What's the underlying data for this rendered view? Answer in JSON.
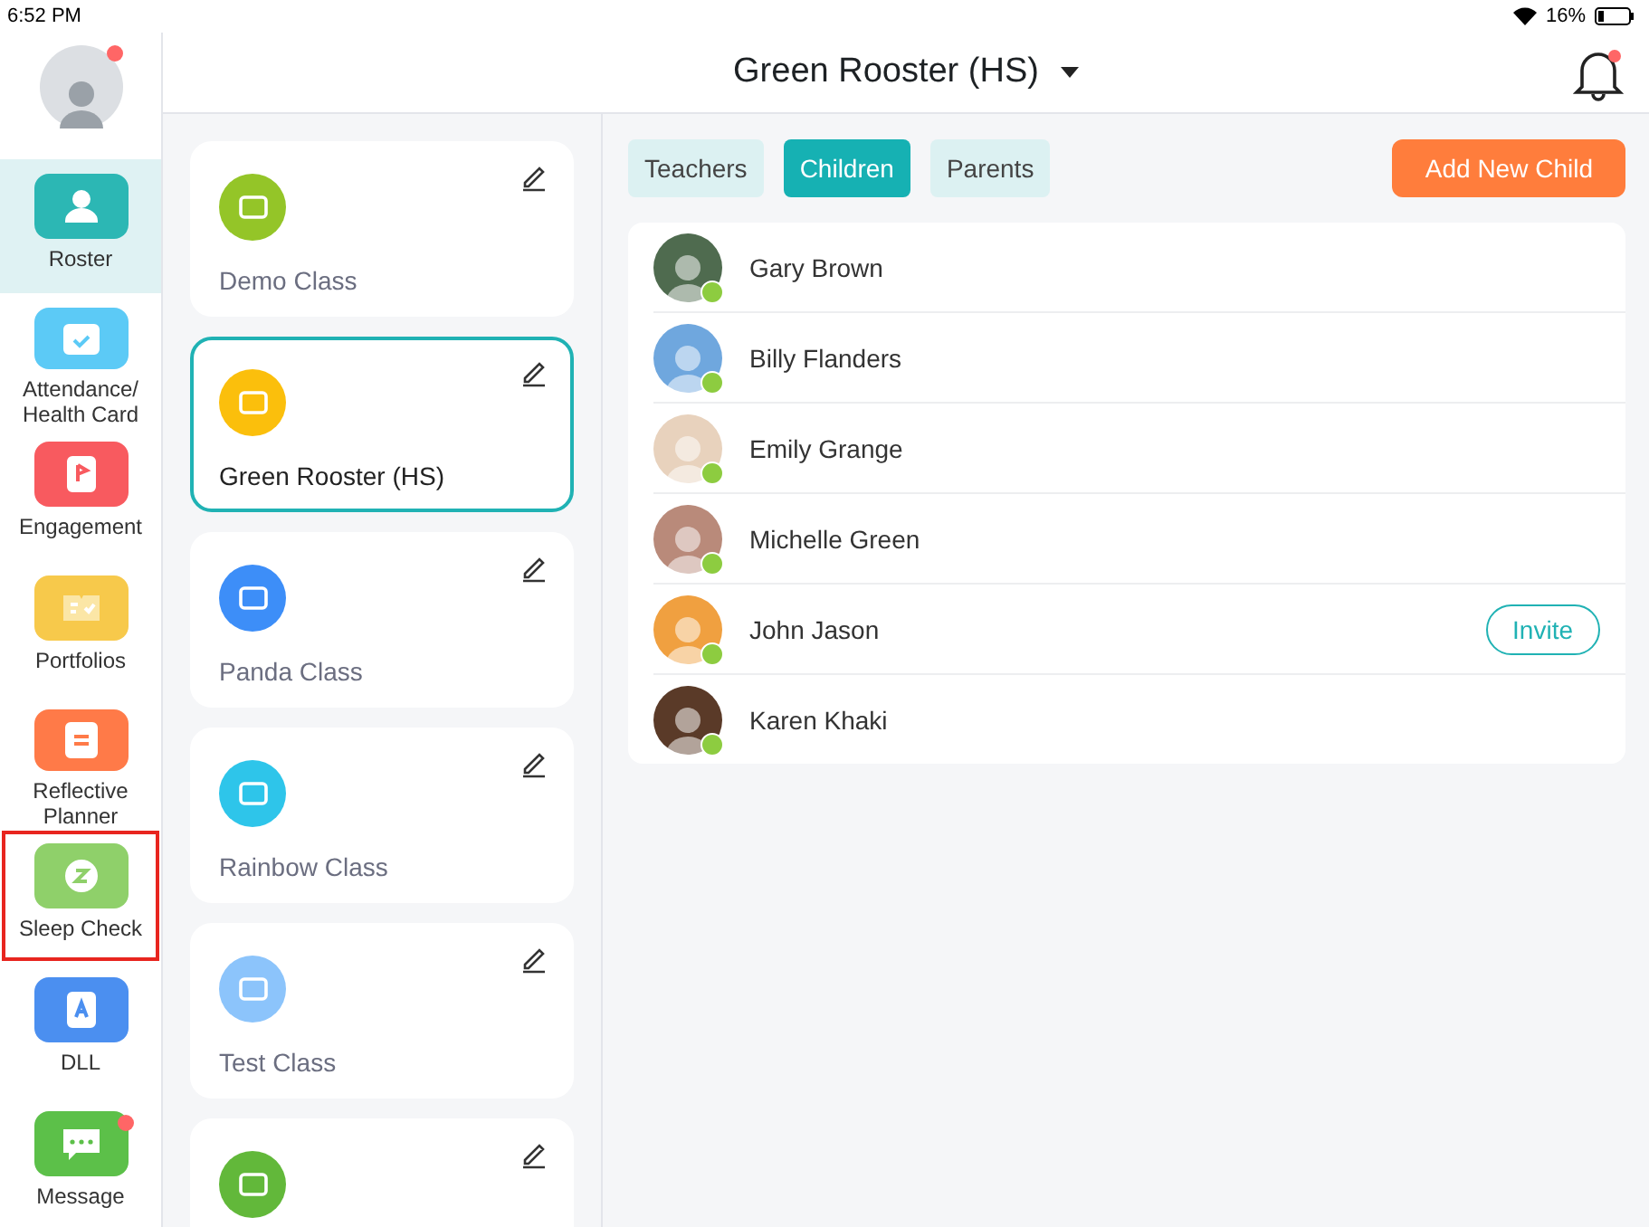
{
  "status_bar": {
    "time": "6:52 PM",
    "battery": "16%"
  },
  "user": {
    "notification": true
  },
  "nav": [
    {
      "label": "Roster",
      "kind": "person",
      "color": "#2cb7b4",
      "selected": true,
      "outlined": false,
      "badge": false
    },
    {
      "label": "Attendance/ Health Card",
      "kind": "calendar",
      "color": "#5ccaf6",
      "selected": false,
      "outlined": false,
      "badge": false
    },
    {
      "label": "Engagement",
      "kind": "flag",
      "color": "#f85a5f",
      "selected": false,
      "outlined": false,
      "badge": false
    },
    {
      "label": "Portfolios",
      "kind": "book",
      "color": "#f7c94b",
      "selected": false,
      "outlined": false,
      "badge": false
    },
    {
      "label": "Reflective Planner",
      "kind": "planner",
      "color": "#ff7a48",
      "selected": false,
      "outlined": false,
      "badge": false
    },
    {
      "label": "Sleep Check",
      "kind": "clock",
      "color": "#8fd06a",
      "selected": false,
      "outlined": true,
      "badge": false
    },
    {
      "label": "DLL",
      "kind": "letter",
      "color": "#4b8ff0",
      "selected": false,
      "outlined": false,
      "badge": false
    },
    {
      "label": "Message",
      "kind": "chat",
      "color": "#5cc049",
      "selected": false,
      "outlined": false,
      "badge": true
    }
  ],
  "header": {
    "title": "Green Rooster (HS)",
    "notification": true
  },
  "classes": [
    {
      "name": "Demo Class",
      "color": "#94c528",
      "selected": false
    },
    {
      "name": "Green Rooster (HS)",
      "color": "#fbbf0c",
      "selected": true
    },
    {
      "name": "Panda Class",
      "color": "#3d8ef8",
      "selected": false
    },
    {
      "name": "Rainbow Class",
      "color": "#2ec5ea",
      "selected": false
    },
    {
      "name": "Test Class",
      "color": "#8cc4fb",
      "selected": false
    },
    {
      "color": "#62b83a",
      "selected": false
    }
  ],
  "tabs": [
    {
      "label": "Teachers",
      "selected": false
    },
    {
      "label": "Children",
      "selected": true
    },
    {
      "label": "Parents",
      "selected": false
    }
  ],
  "add_button": "Add New Child",
  "children": [
    {
      "name": "Gary Brown",
      "color": "#4f6b4f"
    },
    {
      "name": "Billy Flanders",
      "color": "#6fa7de"
    },
    {
      "name": "Emily Grange",
      "color": "#e8d2bd"
    },
    {
      "name": "Michelle Green",
      "color": "#b98a7a"
    },
    {
      "name": "John Jason",
      "color": "#f0a040",
      "invite": "Invite"
    },
    {
      "name": "Karen Khaki",
      "color": "#5a3a28"
    }
  ]
}
